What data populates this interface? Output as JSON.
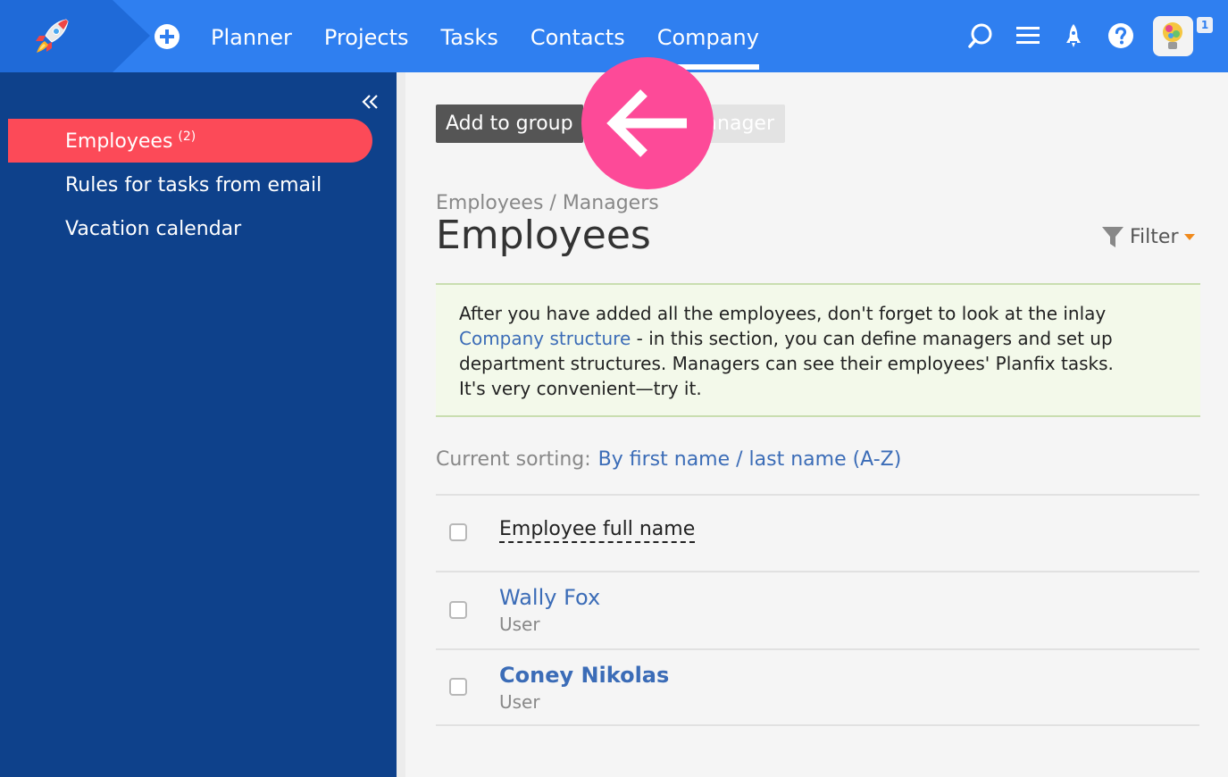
{
  "topbar": {
    "nav": [
      "Planner",
      "Projects",
      "Tasks",
      "Contacts",
      "Company"
    ],
    "active_nav": "Company",
    "avatar_badge": "1",
    "accent_color": "#2f7ff0"
  },
  "sidebar": {
    "items": [
      {
        "label": "Employees",
        "count": "(2)",
        "active": true
      },
      {
        "label": "Rules for tasks from email"
      },
      {
        "label": "Vacation calendar"
      }
    ],
    "bg_color": "#0e418b",
    "active_color": "#fc4a58"
  },
  "toolbar": {
    "add_group_label": "Add to group",
    "manager_label": "anager"
  },
  "breadcrumb": "Employees / Managers",
  "page_title": "Employees",
  "filter_label": "Filter",
  "notice": {
    "line1": "After you have added all the employees, don't forget to look at the inlay",
    "link": "Company structure",
    "line2": " - in this section, you can define managers and set up",
    "line3": "department structures. Managers can see their employees' Planfix tasks.",
    "line4": "It's very convenient—try it."
  },
  "sorting": {
    "label": "Current sorting:",
    "value": "By first name / last name (A-Z)"
  },
  "table": {
    "column_header": "Employee full name",
    "rows": [
      {
        "name": "Wally Fox",
        "role": "User",
        "bold": false
      },
      {
        "name": "Coney Nikolas",
        "role": "User",
        "bold": true
      }
    ]
  }
}
